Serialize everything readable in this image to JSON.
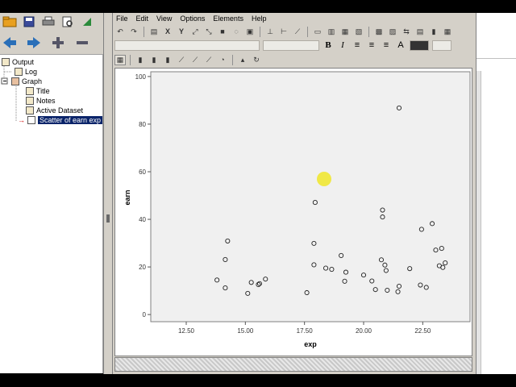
{
  "toolbar_icons": [
    "folder-icon",
    "save-icon",
    "print-icon",
    "preview-icon",
    "export-icon"
  ],
  "nav_icons": [
    "back-arrow-icon",
    "forward-arrow-icon",
    "expand-plus-icon",
    "collapse-minus-icon"
  ],
  "tree": {
    "items": [
      {
        "label": "Output",
        "icon": "output-icon"
      },
      {
        "label": "Log",
        "icon": "log-icon"
      },
      {
        "label": "Graph",
        "icon": "graph-icon"
      },
      {
        "label": "Title",
        "icon": "title-icon"
      },
      {
        "label": "Notes",
        "icon": "notes-icon"
      },
      {
        "label": "Active Dataset",
        "icon": "dataset-icon"
      },
      {
        "label": "Scatter of earn exp",
        "icon": "scatter-icon",
        "selected": true
      }
    ]
  },
  "editor": {
    "menu": [
      "File",
      "Edit",
      "View",
      "Options",
      "Elements",
      "Help"
    ],
    "format_buttons": {
      "bold": "B",
      "italic": "I",
      "font": "A"
    }
  },
  "chart_data": {
    "type": "scatter",
    "xlabel": "exp",
    "ylabel": "earn",
    "xlim": [
      11,
      24.5
    ],
    "ylim": [
      -3,
      102
    ],
    "xticks": [
      "12.50",
      "15.00",
      "17.50",
      "20.00",
      "22.50"
    ],
    "xtick_values": [
      12.5,
      15,
      17.5,
      20,
      22.5
    ],
    "yticks": [
      "0",
      "20",
      "40",
      "60",
      "80",
      "100"
    ],
    "ytick_values": [
      0,
      20,
      40,
      60,
      80,
      100
    ],
    "points": [
      [
        13.8,
        14.5
      ],
      [
        14.15,
        11.2
      ],
      [
        14.15,
        23.1
      ],
      [
        14.25,
        30.9
      ],
      [
        15.1,
        8.9
      ],
      [
        15.25,
        13.5
      ],
      [
        15.55,
        12.6
      ],
      [
        15.6,
        13.0
      ],
      [
        15.85,
        14.9
      ],
      [
        17.6,
        9.2
      ],
      [
        17.9,
        29.9
      ],
      [
        17.9,
        20.9
      ],
      [
        17.95,
        47.1
      ],
      [
        18.4,
        19.5
      ],
      [
        18.65,
        19.0
      ],
      [
        19.05,
        24.8
      ],
      [
        19.2,
        14.0
      ],
      [
        19.25,
        17.8
      ],
      [
        20.0,
        16.6
      ],
      [
        20.35,
        14.1
      ],
      [
        20.5,
        10.5
      ],
      [
        20.75,
        23.0
      ],
      [
        20.8,
        43.9
      ],
      [
        20.8,
        41.0
      ],
      [
        20.9,
        20.8
      ],
      [
        20.95,
        18.5
      ],
      [
        21.0,
        10.2
      ],
      [
        21.45,
        9.6
      ],
      [
        21.5,
        11.9
      ],
      [
        21.5,
        86.8
      ],
      [
        21.95,
        19.3
      ],
      [
        22.4,
        12.4
      ],
      [
        22.45,
        35.8
      ],
      [
        22.65,
        11.4
      ],
      [
        22.9,
        38.2
      ],
      [
        23.05,
        27.1
      ],
      [
        23.2,
        20.5
      ],
      [
        23.3,
        27.8
      ],
      [
        23.35,
        19.8
      ],
      [
        23.45,
        21.7
      ]
    ]
  }
}
